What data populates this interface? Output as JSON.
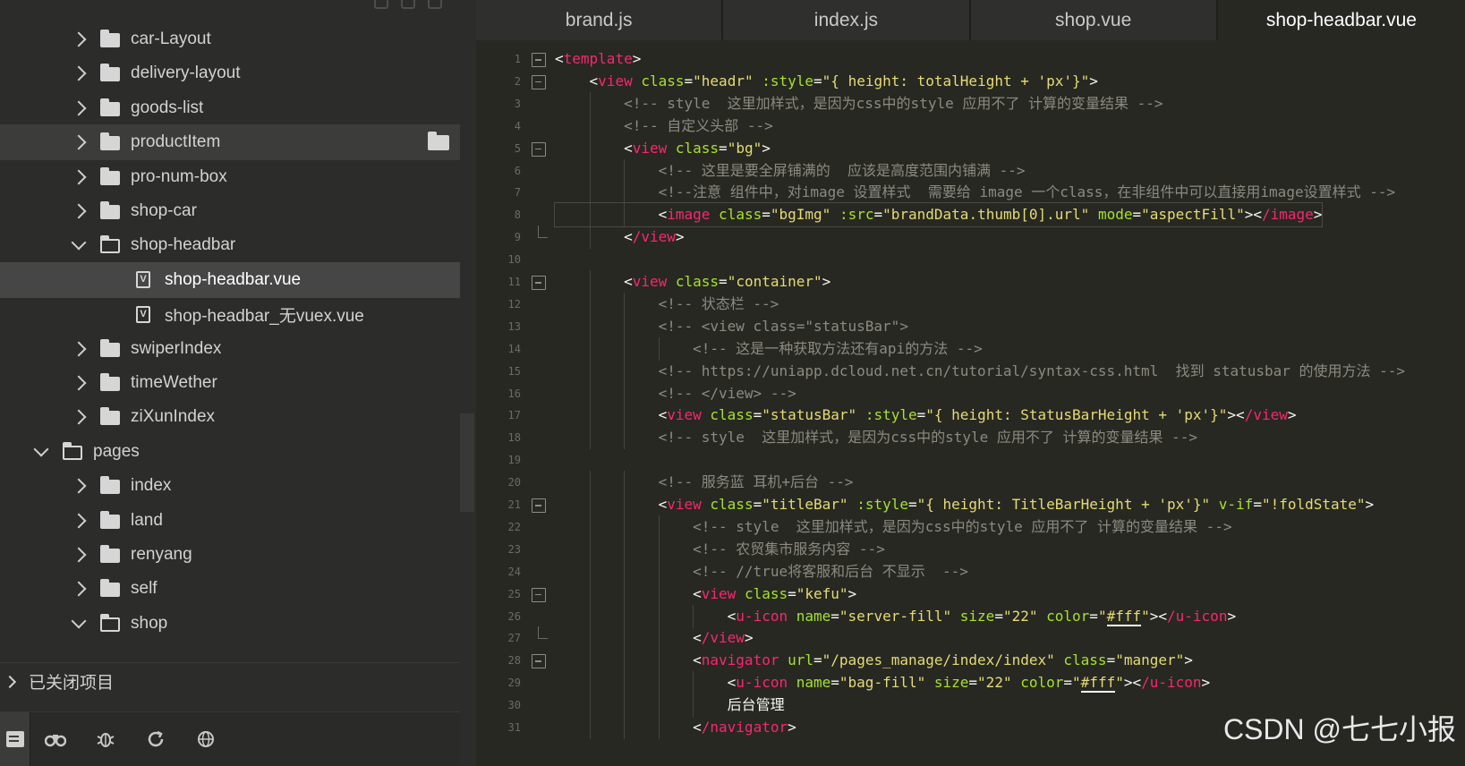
{
  "tabs": [
    {
      "label": "brand.js",
      "active": false
    },
    {
      "label": "index.js",
      "active": false
    },
    {
      "label": "shop.vue",
      "active": false
    },
    {
      "label": "shop-headbar.vue",
      "active": true
    }
  ],
  "tree": [
    {
      "label": "car-Layout",
      "type": "folder",
      "level": 1,
      "expanded": false
    },
    {
      "label": "delivery-layout",
      "type": "folder",
      "level": 1,
      "expanded": false
    },
    {
      "label": "goods-list",
      "type": "folder",
      "level": 1,
      "expanded": false
    },
    {
      "label": "productItem",
      "type": "folder",
      "level": 1,
      "expanded": false,
      "state": "hover"
    },
    {
      "label": "pro-num-box",
      "type": "folder",
      "level": 1,
      "expanded": false
    },
    {
      "label": "shop-car",
      "type": "folder",
      "level": 1,
      "expanded": false
    },
    {
      "label": "shop-headbar",
      "type": "folder",
      "level": 1,
      "expanded": true
    },
    {
      "label": "shop-headbar.vue",
      "type": "vue-file",
      "level": 2,
      "state": "active"
    },
    {
      "label": "shop-headbar_无vuex.vue",
      "type": "vue-file",
      "level": 2
    },
    {
      "label": "swiperIndex",
      "type": "folder",
      "level": 1,
      "expanded": false
    },
    {
      "label": "timeWether",
      "type": "folder",
      "level": 1,
      "expanded": false
    },
    {
      "label": "ziXunIndex",
      "type": "folder",
      "level": 1,
      "expanded": false
    },
    {
      "label": "pages",
      "type": "folder",
      "level": 0,
      "expanded": true
    },
    {
      "label": "index",
      "type": "folder",
      "level": 1,
      "expanded": false
    },
    {
      "label": "land",
      "type": "folder",
      "level": 1,
      "expanded": false
    },
    {
      "label": "renyang",
      "type": "folder",
      "level": 1,
      "expanded": false
    },
    {
      "label": "self",
      "type": "folder",
      "level": 1,
      "expanded": false
    },
    {
      "label": "shop",
      "type": "folder",
      "level": 1,
      "expanded": true
    }
  ],
  "closed_projects_label": "已关闭项目",
  "bottom_icons": [
    "project-icon",
    "binoculars-icon",
    "bug-icon",
    "refresh-icon",
    "globe-icon"
  ],
  "code_lines": [
    {
      "n": "1",
      "text": "<template>"
    },
    {
      "n": "2",
      "text": "    <view class=\"headr\" :style=\"{ height: totalHeight + 'px'}\">"
    },
    {
      "n": "3",
      "text": "        <!-- style  这里加样式，是因为css中的style 应用不了 计算的变量结果 -->"
    },
    {
      "n": "4",
      "text": "        <!-- 自定义头部 -->"
    },
    {
      "n": "5",
      "text": "        <view class=\"bg\">"
    },
    {
      "n": "6",
      "text": "            <!-- 这里是要全屏铺满的  应该是高度范围内铺满 -->"
    },
    {
      "n": "7",
      "text": "            <!--注意 组件中，对image 设置样式  需要给 image 一个class，在非组件中可以直接用image设置样式 -->"
    },
    {
      "n": "8",
      "text": "            <image class=\"bgImg\" :src=\"brandData.thumb[0].url\" mode=\"aspectFill\"></image>"
    },
    {
      "n": "9",
      "text": "        </view>"
    },
    {
      "n": "10",
      "text": ""
    },
    {
      "n": "11",
      "text": "        <view class=\"container\">"
    },
    {
      "n": "12",
      "text": "            <!-- 状态栏 -->"
    },
    {
      "n": "13",
      "text": "            <!-- <view class=\"statusBar\">"
    },
    {
      "n": "14",
      "text": "                <!-- 这是一种获取方法还有api的方法 -->"
    },
    {
      "n": "15",
      "text": "            <!-- https://uniapp.dcloud.net.cn/tutorial/syntax-css.html  找到 statusbar 的使用方法 -->"
    },
    {
      "n": "16",
      "text": "            <!-- </view> -->"
    },
    {
      "n": "17",
      "text": "            <view class=\"statusBar\" :style=\"{ height: StatusBarHeight + 'px'}\"></view>"
    },
    {
      "n": "18",
      "text": "            <!-- style  这里加样式，是因为css中的style 应用不了 计算的变量结果 -->"
    },
    {
      "n": "19",
      "text": ""
    },
    {
      "n": "20",
      "text": "            <!-- 服务蓝 耳机+后台 -->"
    },
    {
      "n": "21",
      "text": "            <view class=\"titleBar\" :style=\"{ height: TitleBarHeight + 'px'}\" v-if=\"!foldState\">"
    },
    {
      "n": "22",
      "text": "                <!-- style  这里加样式，是因为css中的style 应用不了 计算的变量结果 -->"
    },
    {
      "n": "23",
      "text": "                <!-- 农贸集市服务内容 -->"
    },
    {
      "n": "24",
      "text": "                <!-- //true将客服和后台 不显示  -->"
    },
    {
      "n": "25",
      "text": "                <view class=\"kefu\">"
    },
    {
      "n": "26",
      "text": "                    <u-icon name=\"server-fill\" size=\"22\" color=\"#fff\"></u-icon>"
    },
    {
      "n": "27",
      "text": "                </view>"
    },
    {
      "n": "28",
      "text": "                <navigator url=\"/pages_manage/index/index\" class=\"manger\">"
    },
    {
      "n": "29",
      "text": "                    <u-icon name=\"bag-fill\" size=\"22\" color=\"#fff\"></u-icon>"
    },
    {
      "n": "30",
      "text": "                    后台管理"
    },
    {
      "n": "31",
      "text": "                </navigator>"
    }
  ],
  "watermark": "CSDN @七七小报",
  "colors": {
    "tag": "#f92672",
    "attr": "#a6e22e",
    "string": "#e6db74",
    "comment": "#8c8a80",
    "text": "#f8f8f2",
    "editor_bg": "#272822",
    "sidebar_bg": "#2c2c2b"
  }
}
